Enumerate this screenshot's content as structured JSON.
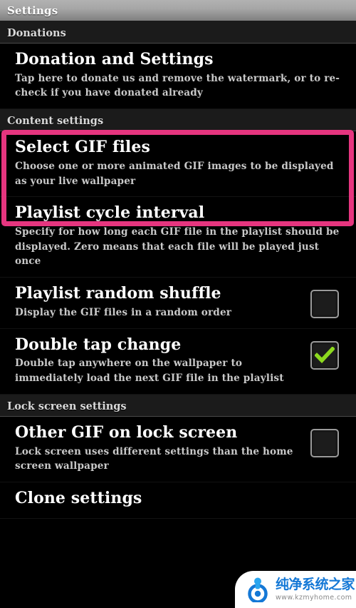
{
  "window": {
    "title": "Settings"
  },
  "sections": [
    {
      "header": "Donations",
      "items": [
        {
          "title": "Donation and Settings",
          "summary": "Tap here to donate us and remove the watermark, or to re-check if you have donated already",
          "widget": "none"
        }
      ]
    },
    {
      "header": "Content settings",
      "items": [
        {
          "title": "Select GIF files",
          "summary": "Choose one or more animated GIF images to be displayed as your live wallpaper",
          "widget": "none",
          "highlighted": true
        },
        {
          "title": "Playlist cycle interval",
          "summary": "Specify for how long each GIF file in the playlist should be displayed. Zero means that each file will be played just once",
          "widget": "none"
        },
        {
          "title": "Playlist random shuffle",
          "summary": "Display the GIF files in a random order",
          "widget": "checkbox",
          "checked": false
        },
        {
          "title": "Double tap change",
          "summary": "Double tap anywhere on the wallpaper to immediately load the next GIF file in the playlist",
          "widget": "checkbox",
          "checked": true
        }
      ]
    },
    {
      "header": "Lock screen settings",
      "items": [
        {
          "title": "Other GIF on lock screen",
          "summary": "Lock screen uses different settings than the home screen wallpaper",
          "widget": "checkbox",
          "checked": false
        },
        {
          "title": "Clone settings",
          "summary": "",
          "widget": "none"
        }
      ]
    }
  ],
  "highlight": {
    "color": "#e6357f",
    "target": "Select GIF files"
  },
  "watermark": {
    "brand": "纯净系统之家",
    "url": "www.kzmyhome.com",
    "accent": "#1478d6"
  },
  "colors": {
    "background": "#000000",
    "section_header_bg": "#1b1b1b",
    "checkmark_green": "#8CD91E",
    "checkbox_border": "#9a9a9a",
    "title_text": "#ffffff",
    "summary_text": "#c9c9c9"
  }
}
